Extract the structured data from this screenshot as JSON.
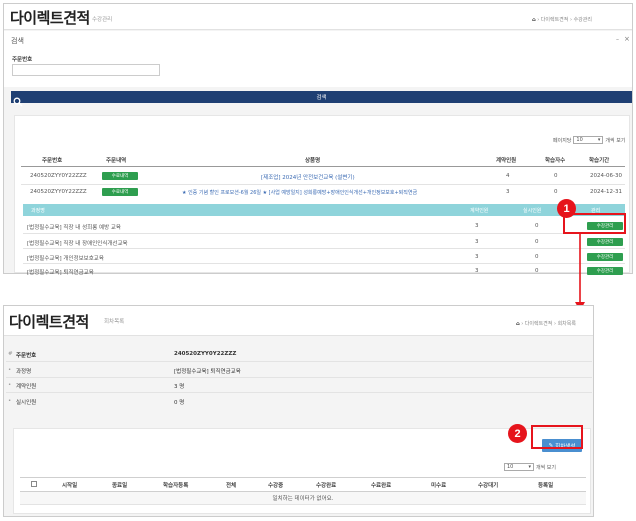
{
  "top": {
    "title": "다이렉트견적",
    "subtitle": "수강관리",
    "breadcrumb": [
      "다이렉트견적",
      "수강관리"
    ],
    "minimize": "–",
    "close": "×",
    "search_section_label": "검색",
    "order_no_label": "주문번호",
    "order_no_value": "",
    "search_bar_label": "검색",
    "per_page_label": "페이지당",
    "per_page_value": "10",
    "per_page_suffix": "개씩 보기",
    "headers": [
      "주문번호",
      "주문내역",
      "상품명",
      "계약인원",
      "학습자수",
      "학습기간"
    ],
    "orders": [
      {
        "order_no": "240520ZYY0Y22ZZZ",
        "btn": "수료내역",
        "product": "[제조업] 2024년 안전보건교육 (설변기)",
        "count": "4",
        "learners": "0",
        "period": "2024-06-30"
      },
      {
        "order_no": "240520ZYY0Y22ZZZ",
        "btn": "수료내역",
        "product": "★ 인증 기념 할인 프로모션-6월 26일 ★ [사업 예방일지] 성희롱예방+장애인인식개선+개인정보보호+퇴직연금",
        "count": "3",
        "learners": "0",
        "period": "2024-12-31"
      }
    ],
    "sub_headers": [
      "과정명",
      "계약인원",
      "실시인원",
      "관리"
    ],
    "courses": [
      {
        "name": "[법정필수교육] 직장 내 성희롱 예방 교육",
        "count": "3",
        "done": "0",
        "btn": "수강관리"
      },
      {
        "name": "[법정필수교육] 직장 내 장애인인식개선교육",
        "count": "3",
        "done": "0",
        "btn": "수강관리"
      },
      {
        "name": "[법정필수교육] 개인정보보호교육",
        "count": "3",
        "done": "0",
        "btn": "수강관리"
      },
      {
        "name": "[법정필수교육] 퇴직연금교육",
        "count": "3",
        "done": "0",
        "btn": "수강관리"
      }
    ]
  },
  "bottom": {
    "title": "다이렉트견적",
    "subtitle": "회차목록",
    "breadcrumb": [
      "다이렉트견적",
      "회차목록"
    ],
    "info": [
      {
        "label": "주문번호",
        "value": "240520ZYY0Y22ZZZ"
      },
      {
        "label": "과정명",
        "value": "[법정필수교육] 퇴직연금교육"
      },
      {
        "label": "계약인원",
        "value": "3 명"
      },
      {
        "label": "실시인원",
        "value": "0 명"
      }
    ],
    "create_btn": "회차생성",
    "per_page_value": "10",
    "per_page_suffix": "개씩 보기",
    "headers": [
      "시작일",
      "종료일",
      "학습자등록",
      "전체",
      "수강중",
      "수강완료",
      "수료완료",
      "미수료",
      "수강대기",
      "등록일"
    ],
    "empty_msg": "일치하는 데이터가 없어요."
  },
  "badges": [
    "1",
    "2"
  ],
  "colors": {
    "accent_red": "#e6141c",
    "header_navy": "#1f3f73",
    "teal": "#8fd4db",
    "green": "#2e9e4f",
    "blue_btn": "#4a8fd0"
  }
}
